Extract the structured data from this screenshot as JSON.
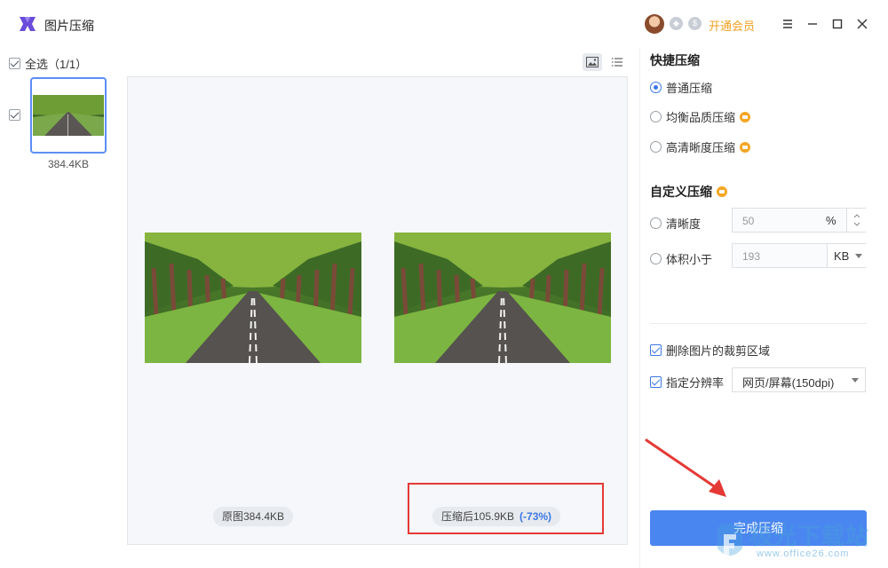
{
  "app": {
    "title": "图片压缩"
  },
  "header": {
    "vip_label": "开通会员",
    "badges": [
      "shield-icon",
      "dollar-icon"
    ]
  },
  "file_list": {
    "select_all_label": "全选（1/1）",
    "select_all_checked": true,
    "items": [
      {
        "size": "384.4KB",
        "checked": true,
        "selected": true
      }
    ]
  },
  "preview": {
    "original_label": "原图384.4KB",
    "compressed_label": "压缩后105.9KB",
    "reduction": "(-73%)"
  },
  "quick_compress": {
    "title": "快捷压缩",
    "options": [
      {
        "label": "普通压缩",
        "selected": true,
        "vip": false
      },
      {
        "label": "均衡品质压缩",
        "selected": false,
        "vip": true
      },
      {
        "label": "高清晰度压缩",
        "selected": false,
        "vip": true
      }
    ]
  },
  "custom_compress": {
    "title": "自定义压缩",
    "clarity": {
      "label": "清晰度",
      "placeholder": "50",
      "unit": "%"
    },
    "size": {
      "label": "体积小于",
      "placeholder": "193",
      "unit": "KB"
    }
  },
  "options": {
    "remove_crop": {
      "label": "删除图片的裁剪区域",
      "checked": true
    },
    "resolution": {
      "label": "指定分辨率",
      "checked": true,
      "value": "网页/屏幕(150dpi)"
    }
  },
  "actions": {
    "done_label": "完成压缩"
  },
  "watermark": {
    "text": "极光下载站",
    "url": "www.office26.com"
  },
  "colors": {
    "accent": "#4a86f0",
    "vip": "#f0a020",
    "highlight": "#e53935"
  }
}
